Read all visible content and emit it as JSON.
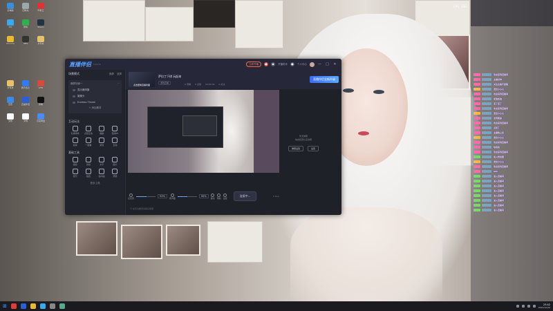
{
  "desktop": {
    "icons_left": [
      {
        "label": "此电脑",
        "color": "#3a8fd8"
      },
      {
        "label": "回收站",
        "color": "#9aa"
      },
      {
        "label": "网易云",
        "color": "#d33"
      },
      {
        "label": "QQ",
        "color": "#3aa8ee"
      },
      {
        "label": "微信",
        "color": "#2bb24c"
      },
      {
        "label": "Steam",
        "color": "#234"
      },
      {
        "label": "Chrome",
        "color": "#e9b930"
      },
      {
        "label": "OBS",
        "color": "#333"
      },
      {
        "label": "文件夹",
        "color": "#e5c16a"
      },
      {
        "label": "文件夹",
        "color": "#e5c16a"
      },
      {
        "label": "腾讯会议",
        "color": "#2f7cf6"
      },
      {
        "label": "WPS",
        "color": "#d64a3b"
      },
      {
        "label": "迅雷",
        "color": "#3c8ae8"
      },
      {
        "label": "直播伴侣",
        "color": "#2b5fd9"
      },
      {
        "label": "剪映",
        "color": "#111"
      },
      {
        "label": "文档",
        "color": "#fff"
      },
      {
        "label": "文档",
        "color": "#fff"
      },
      {
        "label": "百度网盘",
        "color": "#4a8bf5"
      }
    ]
  },
  "app": {
    "logo": "直播伴侣",
    "version": "5.0.2.6",
    "go_live_badge": "立即开播",
    "titlebar_labels": [
      "开播助手",
      "个人中心"
    ],
    "window_controls": [
      "—",
      "□",
      "✕"
    ],
    "sidebar": {
      "header": "场景模式",
      "header_actions": [
        "横屏",
        "竖屏"
      ],
      "scene_title": "横屏场景一",
      "scene_items": [
        "显示器采集",
        "摄像头",
        "Endless Threat"
      ],
      "add_source": "+ 添加素材",
      "section_interact": "互动玩法",
      "interact_tools": [
        "礼物特效",
        "点赞互动",
        "福袋",
        "连线PK",
        "投票",
        "一起看",
        "游戏",
        "互动"
      ],
      "section_basic": "基础工具",
      "basic_tools": [
        "美颜",
        "滤镜",
        "文字",
        "图片",
        "音乐",
        "贴纸",
        "画中画",
        "录屏"
      ],
      "more_tools": "更多工具"
    },
    "banner": {
      "cover_caption": "点击更换直播封面",
      "room_name": "萨拉丁下棋 玩起来",
      "room_tag": "游戏直播",
      "stats": [
        "0 观看",
        "0 点赞",
        "00:00:00",
        "0 关注"
      ],
      "promo": "直播伴侣全新升级"
    },
    "side_note": {
      "lines": [
        "暂无弹幕",
        "快去和观众互动吧"
      ],
      "buttons": [
        "弹幕设置",
        "设置"
      ]
    },
    "controls": {
      "mic_label": "麦克风",
      "mic_pct": "52%",
      "mic_level": 0.52,
      "speaker_label": "扬声器",
      "speaker_pct": "50%",
      "speaker_level": 0.5,
      "icons": [
        "美化",
        "录制",
        "设置"
      ],
      "go_live": "连接中...",
      "kbps": "0 kb/s"
    },
    "footer_note": "© 如无法推流请联系客服"
  },
  "chat": {
    "fps": "FPS 120",
    "messages": [
      {
        "text": "欢迎来到直播间",
        "type": "normal"
      },
      {
        "text": "主播好帅",
        "type": "normal"
      },
      {
        "text": "关注主播不迷路",
        "type": "normal"
      },
      {
        "text": "送出小心心",
        "type": "gold"
      },
      {
        "text": "欢迎来到直播间",
        "type": "normal"
      },
      {
        "text": "加油加油",
        "type": "normal"
      },
      {
        "text": "来了来了",
        "type": "normal"
      },
      {
        "text": "欢迎来到直播间",
        "type": "normal"
      },
      {
        "text": "送出小心心",
        "type": "gold"
      },
      {
        "text": "这局能赢",
        "type": "normal"
      },
      {
        "text": "欢迎来到直播间",
        "type": "normal"
      },
      {
        "text": "点赞了",
        "type": "normal"
      },
      {
        "text": "主播晚上好",
        "type": "normal"
      },
      {
        "text": "送出小心心",
        "type": "gold"
      },
      {
        "text": "欢迎来到直播间",
        "type": "normal"
      },
      {
        "text": "哈哈哈",
        "type": "normal"
      },
      {
        "text": "欢迎来到直播间",
        "type": "normal"
      },
      {
        "text": "加入粉丝团",
        "type": "green"
      },
      {
        "text": "送出小心心",
        "type": "gold"
      },
      {
        "text": "欢迎来到直播间",
        "type": "normal"
      },
      {
        "text": "666",
        "type": "normal"
      },
      {
        "text": "进入直播间",
        "type": "green"
      },
      {
        "text": "进入直播间",
        "type": "green"
      },
      {
        "text": "进入直播间",
        "type": "green"
      },
      {
        "text": "进入直播间",
        "type": "green"
      },
      {
        "text": "进入直播间",
        "type": "green"
      },
      {
        "text": "进入直播间",
        "type": "green"
      },
      {
        "text": "进入直播间",
        "type": "green"
      },
      {
        "text": "进入直播间",
        "type": "green"
      }
    ]
  },
  "taskbar": {
    "apps": [
      "#e03c3c",
      "#2b5fd9",
      "#e9b930",
      "#3aa8ee",
      "#888",
      "#5a8"
    ],
    "time": "23:42",
    "date": "2023/12/20"
  }
}
